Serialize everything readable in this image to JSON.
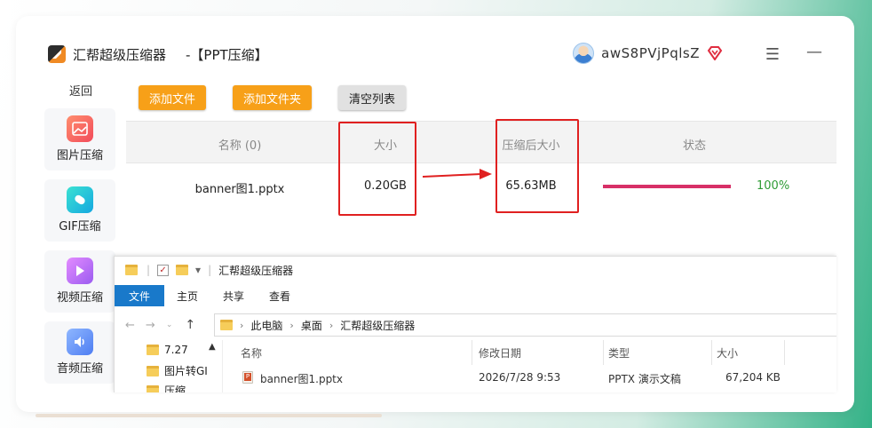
{
  "app": {
    "title": "汇帮超级压缩器",
    "subtitle": "-【PPT压缩】",
    "username": "awS8PVjPqlsZ"
  },
  "icons": {
    "menu": "hamburger-icon",
    "minimize": "minimize-icon",
    "vip": "vip-diamond-icon"
  },
  "sidebar": {
    "back": "返回",
    "items": [
      {
        "label": "图片压缩",
        "icon": "image-icon"
      },
      {
        "label": "GIF压缩",
        "icon": "gif-icon"
      },
      {
        "label": "视频压缩",
        "icon": "video-icon"
      },
      {
        "label": "音频压缩",
        "icon": "audio-icon"
      }
    ]
  },
  "toolbar": {
    "add_file": "添加文件",
    "add_folder": "添加文件夹",
    "clear_list": "清空列表"
  },
  "table": {
    "headers": [
      "名称 (0)",
      "大小",
      "压缩后大小",
      "状态"
    ],
    "rows": [
      {
        "name": "banner图1.pptx",
        "size": "0.20GB",
        "compressed_size": "65.63MB",
        "progress": 1.0,
        "status": "100%"
      }
    ]
  },
  "colors": {
    "accent_orange": "#f7a018",
    "progress": "#d73067",
    "status_green": "#2e9c35",
    "highlight_red": "#e02020",
    "ribbon_blue": "#1979ca"
  },
  "explorer": {
    "title": "汇帮超级压缩器",
    "ribbon_tabs": [
      "文件",
      "主页",
      "共享",
      "查看"
    ],
    "breadcrumb": [
      "此电脑",
      "桌面",
      "汇帮超级压缩器"
    ],
    "nav_items": [
      "7.27",
      "图片转GI",
      "压缩"
    ],
    "columns": [
      "名称",
      "修改日期",
      "类型",
      "大小"
    ],
    "files": [
      {
        "name": "banner图1.pptx",
        "modified": "2026/7/28 9:53",
        "type": "PPTX 演示文稿",
        "size": "67,204 KB"
      }
    ]
  }
}
